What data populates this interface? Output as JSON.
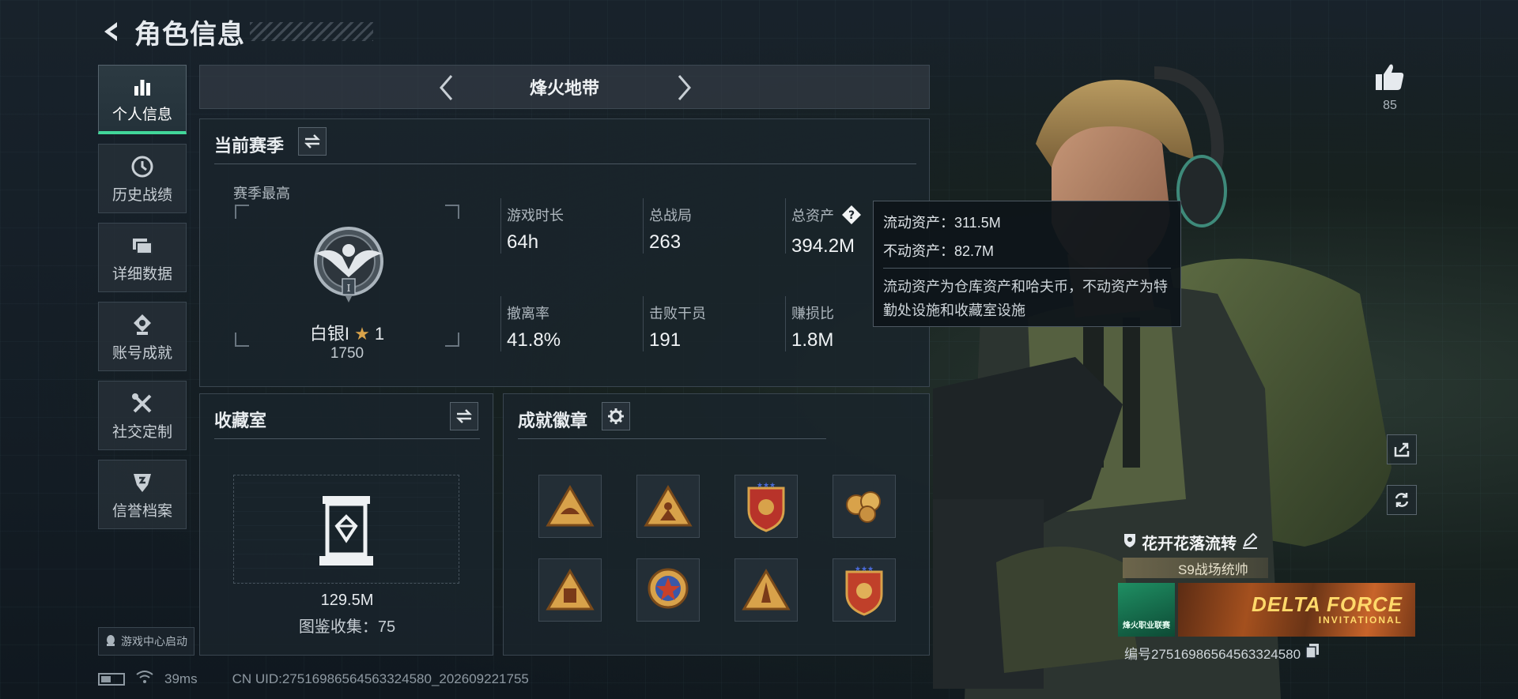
{
  "header": {
    "title": "角色信息"
  },
  "sidebar": {
    "items": [
      {
        "label": "个人信息",
        "icon": "bar-chart-icon",
        "active": true
      },
      {
        "label": "历史战绩",
        "icon": "clock-icon",
        "active": false
      },
      {
        "label": "详细数据",
        "icon": "folder-icon",
        "active": false
      },
      {
        "label": "账号成就",
        "icon": "medal-icon",
        "active": false
      },
      {
        "label": "社交定制",
        "icon": "tools-icon",
        "active": false
      },
      {
        "label": "信誉档案",
        "icon": "shield-icon",
        "active": false
      }
    ],
    "game_center_label": "游戏中心启动"
  },
  "mode": {
    "title": "烽火地带"
  },
  "season": {
    "title": "当前赛季",
    "subtitle": "赛季最高",
    "rank_name": "白银I",
    "rank_stars": "1",
    "rank_score": "1750",
    "rank_numeral": "I",
    "stats": [
      {
        "label": "游戏时长",
        "value": "64h"
      },
      {
        "label": "总战局",
        "value": "263"
      },
      {
        "label": "总资产",
        "value": "394.2M"
      },
      {
        "label": "撤离率",
        "value": "41.8%"
      },
      {
        "label": "击败干员",
        "value": "191"
      },
      {
        "label": "赚损比",
        "value": "1.8M"
      }
    ]
  },
  "tooltip": {
    "liquid": "流动资产：311.5M",
    "fixed": "不动资产：82.7M",
    "description": "流动资产为仓库资产和哈夫币，不动资产为特勤处设施和收藏室设施"
  },
  "vault": {
    "title": "收藏室",
    "value": "129.5M",
    "collection": "图鉴收集：75"
  },
  "badges": {
    "title": "成就徽章",
    "items": [
      "triangle-helmet-badge",
      "triangle-rider-badge",
      "shield-star-badge",
      "gold-cluster-badge",
      "triangle-vest-badge",
      "star-wreath-badge",
      "triangle-rocket-badge",
      "shield-star-badge-2"
    ]
  },
  "player": {
    "likes": "85",
    "name": "花开花落流转",
    "title": "S9战场统帅",
    "banner_left_text": "烽火职业联赛",
    "banner_brand": "DELTA FORCE",
    "banner_sub": "INVITATIONAL",
    "id": "编号27516986564563324580"
  },
  "footer": {
    "ping": "39ms",
    "uid": "CN UID:27516986564563324580_202609221755"
  },
  "colors": {
    "accent": "#42d79a",
    "gold": "#d8a24a",
    "banner": "#ffd96a"
  }
}
